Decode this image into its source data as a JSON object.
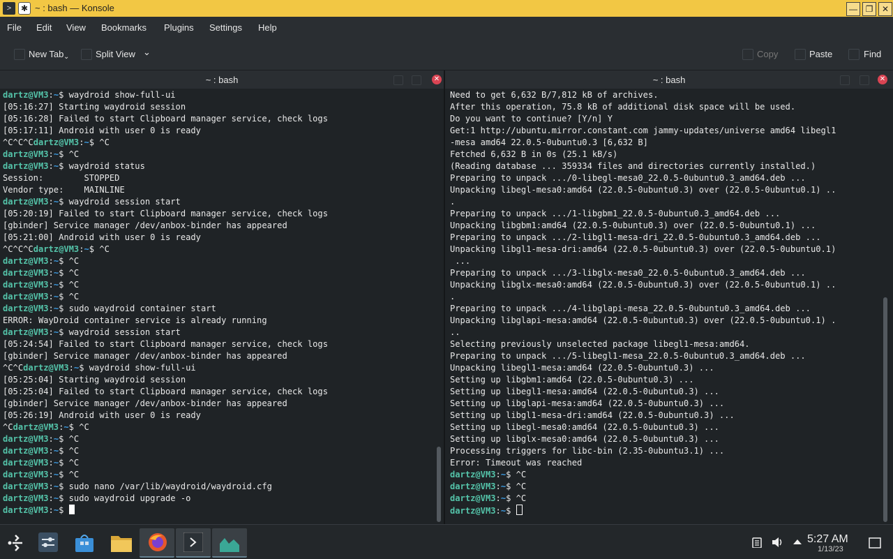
{
  "window": {
    "title": "~ : bash — Konsole",
    "accent": "#f2c744"
  },
  "menu": [
    "File",
    "Edit",
    "View",
    "Bookmarks",
    "Plugins",
    "Settings",
    "Help"
  ],
  "toolbar": {
    "new_tab": "New Tab",
    "split_view": "Split View",
    "copy": "Copy",
    "paste": "Paste",
    "find": "Find"
  },
  "panes": {
    "left_title": "~ : bash",
    "right_title": "~ : bash",
    "left": [
      [
        "p",
        "waydroid show-full-ui"
      ],
      [
        "t",
        "[05:16:27] Starting waydroid session"
      ],
      [
        "t",
        "[05:16:28] Failed to start Clipboard manager service, check logs"
      ],
      [
        "t",
        "[05:17:11] Android with user 0 is ready"
      ],
      [
        "c",
        "^C^C^C",
        "^C"
      ],
      [
        "p",
        "^C"
      ],
      [
        "p",
        "waydroid status"
      ],
      [
        "t",
        "Session:        STOPPED"
      ],
      [
        "t",
        "Vendor type:    MAINLINE"
      ],
      [
        "p",
        "waydroid session start"
      ],
      [
        "t",
        "[05:20:19] Failed to start Clipboard manager service, check logs"
      ],
      [
        "t",
        "[gbinder] Service manager /dev/anbox-binder has appeared"
      ],
      [
        "t",
        "[05:21:00] Android with user 0 is ready"
      ],
      [
        "c",
        "^C^C^C",
        "^C"
      ],
      [
        "p",
        "^C"
      ],
      [
        "p",
        "^C"
      ],
      [
        "p",
        "^C"
      ],
      [
        "p",
        "^C"
      ],
      [
        "p",
        "sudo waydroid container start"
      ],
      [
        "t",
        "ERROR: WayDroid container service is already running"
      ],
      [
        "p",
        "waydroid session start"
      ],
      [
        "t",
        "[05:24:54] Failed to start Clipboard manager service, check logs"
      ],
      [
        "t",
        "[gbinder] Service manager /dev/anbox-binder has appeared"
      ],
      [
        "c",
        "^C^C",
        "waydroid show-full-ui"
      ],
      [
        "t",
        "[05:25:04] Starting waydroid session"
      ],
      [
        "t",
        "[05:25:04] Failed to start Clipboard manager service, check logs"
      ],
      [
        "t",
        "[gbinder] Service manager /dev/anbox-binder has appeared"
      ],
      [
        "t",
        "[05:26:19] Android with user 0 is ready"
      ],
      [
        "c",
        "^C",
        "^C"
      ],
      [
        "p",
        "^C"
      ],
      [
        "p",
        "^C"
      ],
      [
        "p",
        "^C"
      ],
      [
        "p",
        "^C"
      ],
      [
        "p",
        "sudo nano /var/lib/waydroid/waydroid.cfg"
      ],
      [
        "p",
        "sudo waydroid upgrade -o"
      ],
      [
        "cur",
        ""
      ]
    ],
    "right": [
      [
        "t",
        "Need to get 6,632 B/7,812 kB of archives."
      ],
      [
        "t",
        "After this operation, 75.8 kB of additional disk space will be used."
      ],
      [
        "t",
        "Do you want to continue? [Y/n] Y"
      ],
      [
        "t",
        "Get:1 http://ubuntu.mirror.constant.com jammy-updates/universe amd64 libegl1"
      ],
      [
        "t",
        "-mesa amd64 22.0.5-0ubuntu0.3 [6,632 B]"
      ],
      [
        "t",
        "Fetched 6,632 B in 0s (25.1 kB/s)"
      ],
      [
        "t",
        "(Reading database ... 359334 files and directories currently installed.)"
      ],
      [
        "t",
        "Preparing to unpack .../0-libegl-mesa0_22.0.5-0ubuntu0.3_amd64.deb ..."
      ],
      [
        "t",
        "Unpacking libegl-mesa0:amd64 (22.0.5-0ubuntu0.3) over (22.0.5-0ubuntu0.1) .."
      ],
      [
        "t",
        "."
      ],
      [
        "t",
        "Preparing to unpack .../1-libgbm1_22.0.5-0ubuntu0.3_amd64.deb ..."
      ],
      [
        "t",
        "Unpacking libgbm1:amd64 (22.0.5-0ubuntu0.3) over (22.0.5-0ubuntu0.1) ..."
      ],
      [
        "t",
        "Preparing to unpack .../2-libgl1-mesa-dri_22.0.5-0ubuntu0.3_amd64.deb ..."
      ],
      [
        "t",
        "Unpacking libgl1-mesa-dri:amd64 (22.0.5-0ubuntu0.3) over (22.0.5-0ubuntu0.1)"
      ],
      [
        "t",
        " ..."
      ],
      [
        "t",
        "Preparing to unpack .../3-libglx-mesa0_22.0.5-0ubuntu0.3_amd64.deb ..."
      ],
      [
        "t",
        "Unpacking libglx-mesa0:amd64 (22.0.5-0ubuntu0.3) over (22.0.5-0ubuntu0.1) .."
      ],
      [
        "t",
        "."
      ],
      [
        "t",
        "Preparing to unpack .../4-libglapi-mesa_22.0.5-0ubuntu0.3_amd64.deb ..."
      ],
      [
        "t",
        "Unpacking libglapi-mesa:amd64 (22.0.5-0ubuntu0.3) over (22.0.5-0ubuntu0.1) ."
      ],
      [
        "t",
        ".."
      ],
      [
        "t",
        "Selecting previously unselected package libegl1-mesa:amd64."
      ],
      [
        "t",
        "Preparing to unpack .../5-libegl1-mesa_22.0.5-0ubuntu0.3_amd64.deb ..."
      ],
      [
        "t",
        "Unpacking libegl1-mesa:amd64 (22.0.5-0ubuntu0.3) ..."
      ],
      [
        "t",
        "Setting up libgbm1:amd64 (22.0.5-0ubuntu0.3) ..."
      ],
      [
        "t",
        "Setting up libegl1-mesa:amd64 (22.0.5-0ubuntu0.3) ..."
      ],
      [
        "t",
        "Setting up libglapi-mesa:amd64 (22.0.5-0ubuntu0.3) ..."
      ],
      [
        "t",
        "Setting up libgl1-mesa-dri:amd64 (22.0.5-0ubuntu0.3) ..."
      ],
      [
        "t",
        "Setting up libegl-mesa0:amd64 (22.0.5-0ubuntu0.3) ..."
      ],
      [
        "t",
        "Setting up libglx-mesa0:amd64 (22.0.5-0ubuntu0.3) ..."
      ],
      [
        "t",
        "Processing triggers for libc-bin (2.35-0ubuntu3.1) ..."
      ],
      [
        "t",
        "Error: Timeout was reached"
      ],
      [
        "p",
        "^C"
      ],
      [
        "p",
        "^C"
      ],
      [
        "p",
        "^C"
      ],
      [
        "curh",
        ""
      ]
    ]
  },
  "prompt": {
    "user": "dartz@VM3",
    "path": "~",
    "symbol": "$"
  },
  "taskbar": {
    "time": "5:27 AM",
    "date": "1/13/23"
  },
  "icons": [
    "konsole-icon",
    "pin-icon",
    "minimize-icon",
    "maximize-icon",
    "close-icon",
    "app-launcher-icon",
    "settings-icon",
    "discover-icon",
    "files-icon",
    "firefox-icon",
    "konsole-task-icon",
    "system-monitor-icon",
    "clipboard-icon",
    "volume-icon",
    "tray-expand-icon",
    "show-desktop-icon"
  ]
}
